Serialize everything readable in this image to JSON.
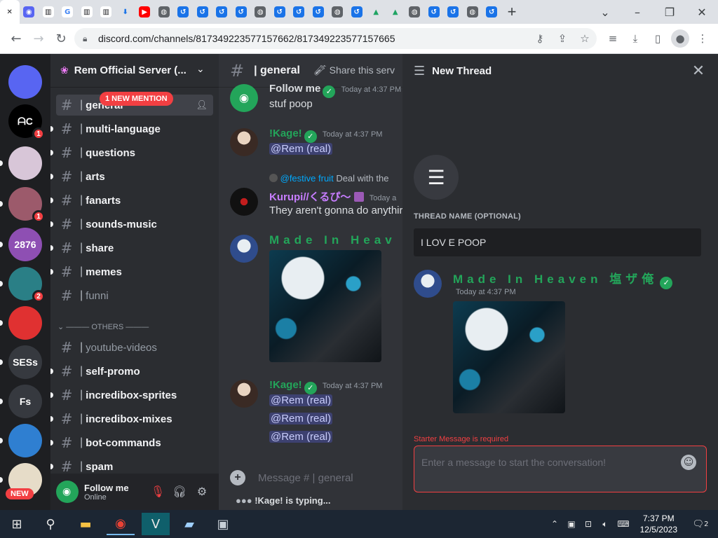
{
  "browser": {
    "tabs": [
      {
        "icon": "close-icon",
        "glyph": "✕",
        "bg": "transparent",
        "fg": "#202124"
      },
      {
        "icon": "discord-icon",
        "glyph": "◉",
        "bg": "#5865f2",
        "fg": "#ffffff"
      },
      {
        "icon": "wiki-icon",
        "glyph": "▥",
        "bg": "#ffffff",
        "fg": "#202124"
      },
      {
        "icon": "google-icon",
        "glyph": "G",
        "bg": "#ffffff",
        "fg": "#4285f4"
      },
      {
        "icon": "wiki-icon",
        "glyph": "▥",
        "bg": "#ffffff",
        "fg": "#202124"
      },
      {
        "icon": "wiki-icon",
        "glyph": "▥",
        "bg": "#ffffff",
        "fg": "#202124"
      },
      {
        "icon": "download-icon",
        "glyph": "⬇",
        "bg": "transparent",
        "fg": "#1a73e8"
      },
      {
        "icon": "youtube-icon",
        "glyph": "▶",
        "bg": "#ff0000",
        "fg": "#ffffff"
      },
      {
        "icon": "globe-icon",
        "glyph": "◍",
        "bg": "#5f6368",
        "fg": "#ffffff"
      },
      {
        "icon": "link-icon",
        "glyph": "↺",
        "bg": "#1a73e8",
        "fg": "#ffffff"
      },
      {
        "icon": "link-icon",
        "glyph": "↺",
        "bg": "#1a73e8",
        "fg": "#ffffff"
      },
      {
        "icon": "link-icon",
        "glyph": "↺",
        "bg": "#1a73e8",
        "fg": "#ffffff"
      },
      {
        "icon": "link-icon",
        "glyph": "↺",
        "bg": "#1a73e8",
        "fg": "#ffffff"
      },
      {
        "icon": "globe-icon",
        "glyph": "◍",
        "bg": "#5f6368",
        "fg": "#ffffff"
      },
      {
        "icon": "link-icon",
        "glyph": "↺",
        "bg": "#1a73e8",
        "fg": "#ffffff"
      },
      {
        "icon": "link-icon",
        "glyph": "↺",
        "bg": "#1a73e8",
        "fg": "#ffffff"
      },
      {
        "icon": "link-icon",
        "glyph": "↺",
        "bg": "#1a73e8",
        "fg": "#ffffff"
      },
      {
        "icon": "globe-icon",
        "glyph": "◍",
        "bg": "#5f6368",
        "fg": "#ffffff"
      },
      {
        "icon": "link-icon",
        "glyph": "↺",
        "bg": "#1a73e8",
        "fg": "#ffffff"
      },
      {
        "icon": "drive-icon",
        "glyph": "▲",
        "bg": "transparent",
        "fg": "#1fa463"
      },
      {
        "icon": "drive-icon",
        "glyph": "▲",
        "bg": "transparent",
        "fg": "#1fa463"
      },
      {
        "icon": "globe-icon",
        "glyph": "◍",
        "bg": "#5f6368",
        "fg": "#ffffff"
      },
      {
        "icon": "link-icon",
        "glyph": "↺",
        "bg": "#1a73e8",
        "fg": "#ffffff"
      },
      {
        "icon": "link-icon",
        "glyph": "↺",
        "bg": "#1a73e8",
        "fg": "#ffffff"
      },
      {
        "icon": "globe-icon",
        "glyph": "◍",
        "bg": "#5f6368",
        "fg": "#ffffff"
      },
      {
        "icon": "link-icon",
        "glyph": "↺",
        "bg": "#1a73e8",
        "fg": "#ffffff"
      }
    ],
    "new_tab_glyph": "+",
    "url": "discord.com/channels/817349223577157662/817349223577157665",
    "accent": "#1a73e8"
  },
  "server": {
    "name": "Rem Official Server (..."
  },
  "rail": [
    {
      "label": "",
      "icon": "discord-home-icon",
      "bg": "#5865f2",
      "badge": ""
    },
    {
      "label": "ᗩC",
      "icon": "server-ac-icon",
      "bg": "#000000",
      "badge": "1"
    },
    {
      "label": "",
      "icon": "server-anime-icon",
      "bg": "#d8c6d8",
      "badge": ""
    },
    {
      "label": "",
      "icon": "server-anime2-icon",
      "bg": "#9c5a6b",
      "badge": "1"
    },
    {
      "label": "2876",
      "icon": "server-2876-icon",
      "bg": "#8e4fb3",
      "badge": ""
    },
    {
      "label": "",
      "icon": "server-teal-icon",
      "bg": "#2a7f86",
      "badge": "2"
    },
    {
      "label": "",
      "icon": "server-red-icon",
      "bg": "#e03131",
      "badge": ""
    },
    {
      "label": "SESs",
      "icon": "server-sess-icon",
      "bg": "#36393f",
      "badge": ""
    },
    {
      "label": "Fs",
      "icon": "server-fs-icon",
      "bg": "#36393f",
      "badge": ""
    },
    {
      "label": "",
      "icon": "server-art-icon",
      "bg": "#2f7fd1",
      "badge": ""
    },
    {
      "label": "",
      "icon": "server-logo-icon",
      "bg": "#e6dcc8",
      "badge": ""
    }
  ],
  "rail_new_label": "NEW",
  "channels": {
    "mention_pill": "1 NEW MENTION",
    "others_label": "OTHERS",
    "list": [
      {
        "name": "general",
        "muted": false
      },
      {
        "name": "multi-language",
        "muted": false
      },
      {
        "name": "questions",
        "muted": false
      },
      {
        "name": "arts",
        "muted": false
      },
      {
        "name": "fanarts",
        "muted": false
      },
      {
        "name": "sounds-music",
        "muted": false
      },
      {
        "name": "share",
        "muted": false
      },
      {
        "name": "memes",
        "muted": false
      },
      {
        "name": "funni",
        "muted": true
      },
      {
        "name": "youtube-videos",
        "muted": true
      },
      {
        "name": "self-promo",
        "muted": false
      },
      {
        "name": "incredibox-sprites",
        "muted": false
      },
      {
        "name": "incredibox-mixes",
        "muted": false
      },
      {
        "name": "bot-commands",
        "muted": false
      },
      {
        "name": "spam",
        "muted": false
      }
    ]
  },
  "user": {
    "name": "Follow me",
    "status": "Online"
  },
  "chat": {
    "channel": "| general",
    "share": "Share this serv",
    "messages": [
      {
        "author": "Follow me",
        "time": "Today at 4:37 PM",
        "text": "stuf poop",
        "color": "#f2f3f5"
      },
      {
        "author": "!Kage!",
        "time": "Today at 4:37 PM",
        "text": "@Rem (real)",
        "color": "#23a55a"
      },
      {
        "reply_author": "@festive fruit",
        "reply_text": "Deal with the",
        "author": "Kurupi//くるぴ〜",
        "time": "Today a",
        "text": "They aren't gonna do anythir",
        "color": "#c77dff"
      },
      {
        "author": "Made In Heav",
        "time": "",
        "text": "",
        "color": "#23a55a"
      },
      {
        "author": "!Kage!",
        "time": "Today at 4:37 PM",
        "text": "@Rem (real)",
        "color": "#23a55a"
      }
    ],
    "extra_mentions": [
      "@Rem (real)",
      "@Rem (real)"
    ],
    "composer_placeholder": "Message # | general",
    "typing_text": "!Kage! is typing..."
  },
  "thread": {
    "title": "New Thread",
    "name_label": "THREAD NAME (OPTIONAL)",
    "name_value": "I LOV E POOP",
    "starter_author": "Made In Heaven 塩ザ俺",
    "starter_time": "Today at 4:37 PM",
    "error_label": "Starter Message is required",
    "starter_placeholder": "Enter a message to start the conversation!"
  },
  "taskbar": {
    "time": "7:37 PM",
    "date": "12/5/2023",
    "notification_count": "2"
  }
}
